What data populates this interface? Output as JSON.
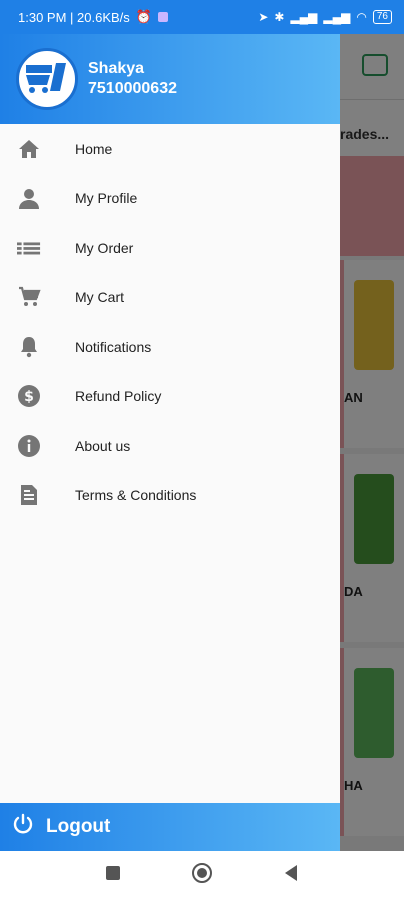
{
  "status_bar": {
    "time_speed": "1:30 PM | 20.6KB/s",
    "battery": "76"
  },
  "drawer": {
    "user_name": "Shakya",
    "user_phone": "7510000632",
    "logo_icon": "store-cart-logo",
    "items": [
      {
        "label": "Home",
        "icon": "home-icon"
      },
      {
        "label": "My Profile",
        "icon": "person-icon"
      },
      {
        "label": "My Order",
        "icon": "list-icon"
      },
      {
        "label": "My Cart",
        "icon": "cart-icon"
      },
      {
        "label": "Notifications",
        "icon": "bell-icon"
      },
      {
        "label": "Refund Policy",
        "icon": "dollar-icon"
      },
      {
        "label": "About us",
        "icon": "info-icon"
      },
      {
        "label": "Terms & Conditions",
        "icon": "document-icon"
      }
    ],
    "logout_label": "Logout"
  },
  "background": {
    "strip_text": "rades...",
    "card_labels": [
      "AN",
      "DA",
      "HA"
    ]
  },
  "colors": {
    "brand_blue": "#1f80e6",
    "brand_light": "#5ab7f5"
  }
}
